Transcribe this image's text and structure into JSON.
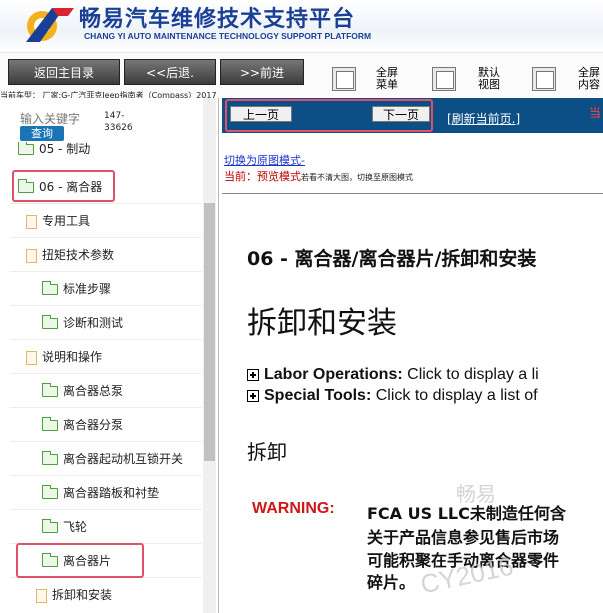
{
  "header": {
    "title_cn": "畅易汽车维修技术支持平台",
    "title_en": "CHANG YI AUTO MAINTENANCE TECHNOLOGY SUPPORT PLATFORM",
    "logo_icon": "chang-yi-logo",
    "brand_color": "#1a3f96"
  },
  "toolbar": {
    "back_home": "返回主目录",
    "back": "<<后退.",
    "forward": ">>前进",
    "fullscreen_menu": [
      "全屏",
      "菜单"
    ],
    "default_view": [
      "默认",
      "视图"
    ],
    "fullscreen_content": [
      "全屏",
      "内容"
    ]
  },
  "vehicle_info": "当前车型：  厂家:G-广汽菲克Jeep指南者（Compass）2017",
  "search": {
    "placeholder": "输入关键字",
    "button": "查询",
    "code_line1": "147-",
    "code_line2": "33626"
  },
  "tree": {
    "partial_top": "05 - 制动",
    "items": [
      {
        "label": "06 - 离合器",
        "icon": "folder-open-icon"
      },
      {
        "label": "专用工具",
        "icon": "document-icon"
      },
      {
        "label": "扭矩技术参数",
        "icon": "document-icon"
      },
      {
        "label": "标准步骤",
        "icon": "folder-icon"
      },
      {
        "label": "诊断和测试",
        "icon": "folder-icon"
      },
      {
        "label": "说明和操作",
        "icon": "document-icon"
      },
      {
        "label": "离合器总泵",
        "icon": "folder-icon"
      },
      {
        "label": "离合器分泵",
        "icon": "folder-icon"
      },
      {
        "label": "离合器起动机互锁开关",
        "icon": "folder-icon"
      },
      {
        "label": "离合器踏板和衬垫",
        "icon": "folder-icon"
      },
      {
        "label": "飞轮",
        "icon": "folder-icon"
      },
      {
        "label": "离合器片",
        "icon": "folder-open-icon"
      },
      {
        "label": "拆卸和安装",
        "icon": "document-icon"
      }
    ]
  },
  "nav": {
    "prev_page": "上一页",
    "next_page": "下一页",
    "refresh": "[刷新当前页.]",
    "edge_text": "当",
    "bar_color": "#0c4f86"
  },
  "view_mode": {
    "switch_link": "切换为原图模式-",
    "current_label": "当前：预览模式",
    "current_hint": "若看不清大图，切换至原图模式"
  },
  "document": {
    "title": "06 - 离合器/离合器片/拆卸和安装",
    "heading": "拆卸和安装",
    "labor_label": "Labor Operations:",
    "labor_text": " Click to display a li",
    "tools_label": "Special Tools:",
    "tools_text": " Click to display a list of",
    "removal": "拆卸",
    "warning_label": "WARNING:",
    "warning_lines": [
      "FCA US LLC未制造任何含",
      "关于产品信息参见售后市场",
      "可能积聚在手动离合器零件",
      "碎片。"
    ],
    "warning_color": "#cc1818"
  },
  "watermark": {
    "line1": "畅易",
    "line2": "CY2016"
  },
  "annotations": {
    "highlight_color": "#e0506a"
  }
}
